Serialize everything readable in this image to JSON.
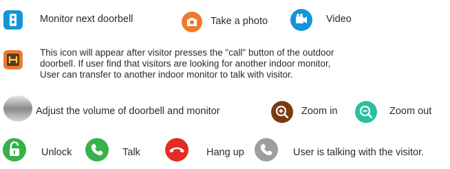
{
  "row1": {
    "monitor_label": "Monitor next doorbell",
    "photo_label": "Take a photo",
    "video_label": "Video"
  },
  "transfer": {
    "line1": "This icon will appear after visitor presses the \"call\" button of the outdoor",
    "line2": "doorbell.  If user find that visitors are looking for another indoor monitor,",
    "line3": "User can transfer to another indoor monitor to talk with visitor."
  },
  "row3": {
    "volume_label": "Adjust the volume of doorbell and monitor",
    "zoom_in_label": "Zoom in",
    "zoom_out_label": "Zoom out"
  },
  "row4": {
    "unlock_label": "Unlock",
    "talk_label": "Talk",
    "hangup_label": "Hang up",
    "talking_label": "User is talking with the visitor."
  },
  "colors": {
    "blue": "#1296db",
    "orange": "#ef7b2e",
    "brown": "#7a3b12",
    "teal": "#2bbf9e",
    "green": "#35b34a",
    "red": "#e42b25",
    "gray": "#9e9e9e"
  }
}
